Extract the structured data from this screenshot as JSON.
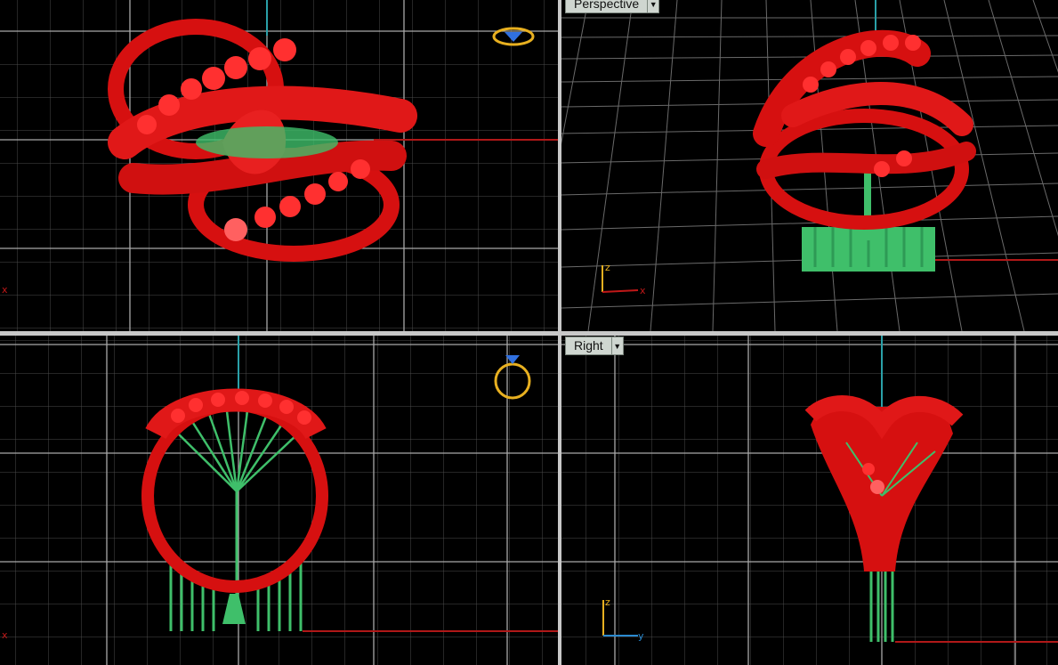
{
  "viewports": {
    "top": {
      "label": ""
    },
    "perspective": {
      "label": "Perspective"
    },
    "front": {
      "label": ""
    },
    "right": {
      "label": "Right"
    }
  },
  "axes": {
    "perspective": {
      "z": "z",
      "x": "x"
    },
    "right": {
      "z": "z",
      "y": "y"
    },
    "top_corner": "x",
    "front_corner": "x"
  },
  "colors": {
    "background": "#000000",
    "grid_minor": "#3a3a3a",
    "grid_major": "#9a9a9a",
    "model": "#e01010",
    "supports": "#3fbf6a",
    "x_axis": "#b01818",
    "y_axis": "#2a8a8a",
    "gem_icon": "#e8b020"
  }
}
